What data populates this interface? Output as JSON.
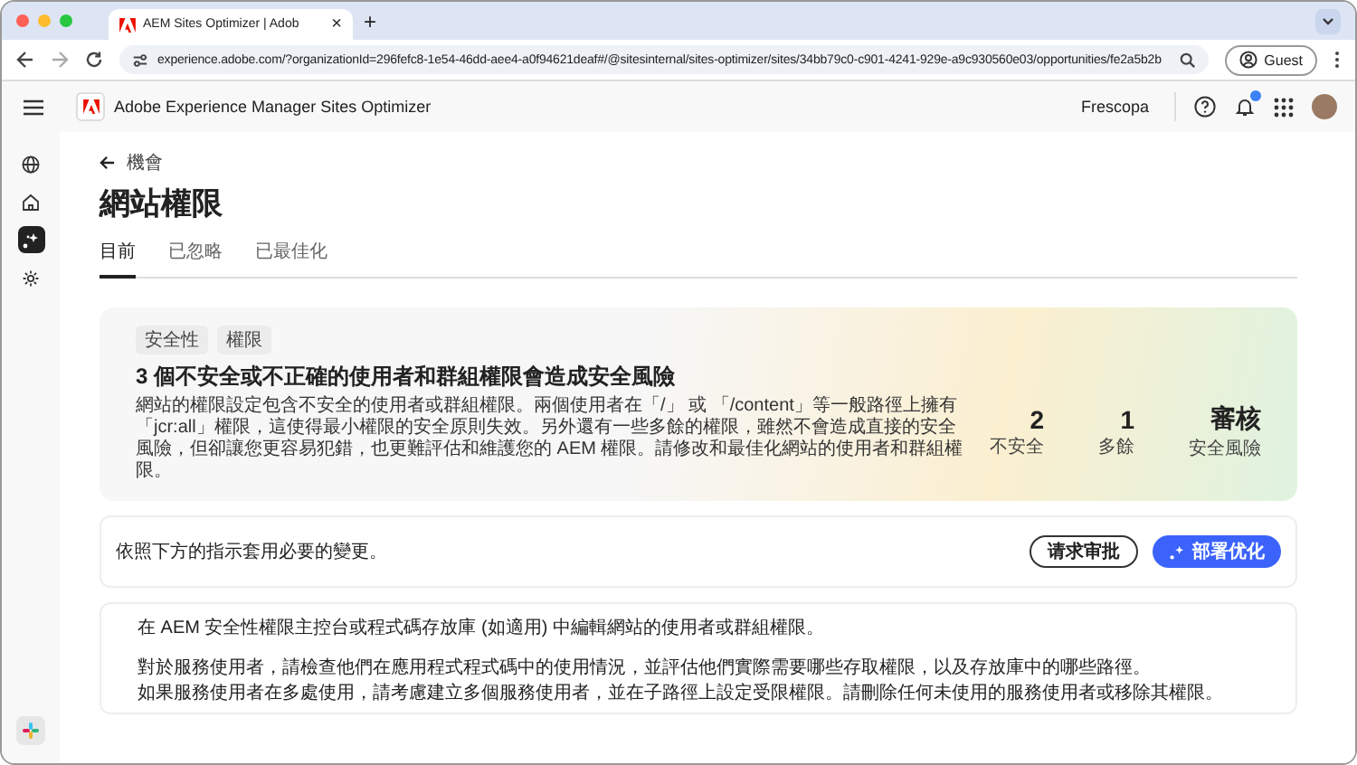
{
  "browser": {
    "tab_title": "AEM Sites Optimizer | Adob",
    "tab_close": "×",
    "new_tab": "+",
    "url": "experience.adobe.com/?organizationId=296fefc8-1e54-46dd-aee4-a0f94621deaf#/@sitesinternal/sites-optimizer/sites/34bb79c0-c901-4241-929e-a9c930560e03/opportunities/fe2a5b2b",
    "profile": "Guest"
  },
  "header": {
    "title": "Adobe Experience Manager Sites Optimizer",
    "org": "Frescopa",
    "notification": true
  },
  "sidebar": {
    "items": [
      {
        "kind": "globe",
        "selected": false
      },
      {
        "kind": "home",
        "selected": false
      },
      {
        "kind": "spark",
        "selected": true
      },
      {
        "kind": "gear",
        "selected": false
      }
    ]
  },
  "page": {
    "back": "機會",
    "title": "網站權限",
    "tabs": [
      {
        "label": "目前",
        "selected": true
      },
      {
        "label": "已忽略",
        "selected": false
      },
      {
        "label": "已最佳化",
        "selected": false
      }
    ]
  },
  "summary": {
    "tags": [
      "安全性",
      "權限"
    ],
    "headline": "3 個不安全或不正確的使用者和群組權限會造成安全風險",
    "description": "網站的權限設定包含不安全的使用者或群組權限。兩個使用者在「/」 或 「/content」等一般路徑上擁有「jcr:all」權限，這使得最小權限的安全原則失效。另外還有一些多餘的權限，雖然不會造成直接的安全風險，但卻讓您更容易犯錯，也更難評估和維護您的 AEM 權限。請修改和最佳化網站的使用者和群組權限。",
    "stats": [
      {
        "value": "2",
        "label": "不安全"
      },
      {
        "value": "1",
        "label": "多餘"
      },
      {
        "value": "審核",
        "label": "安全風險"
      }
    ]
  },
  "action": {
    "text": "依照下方的指示套用必要的變更。",
    "buttons": [
      {
        "label": "请求审批",
        "kind": "outline"
      },
      {
        "label": "部署优化",
        "kind": "primary"
      }
    ]
  },
  "steps": {
    "paragraphs": [
      "在 AEM 安全性權限主控台或程式碼存放庫 (如適用) 中編輯網站的使用者或群組權限。",
      "對於服務使用者，請檢查他們在應用程式程式碼中的使用情況，並評估他們實際需要哪些存取權限，以及存放庫中的哪些路徑。",
      "如果服務使用者在多處使用，請考慮建立多個服務使用者，並在子路徑上設定受限權限。請刪除任何未使用的服務使用者或移除其權限。"
    ]
  }
}
